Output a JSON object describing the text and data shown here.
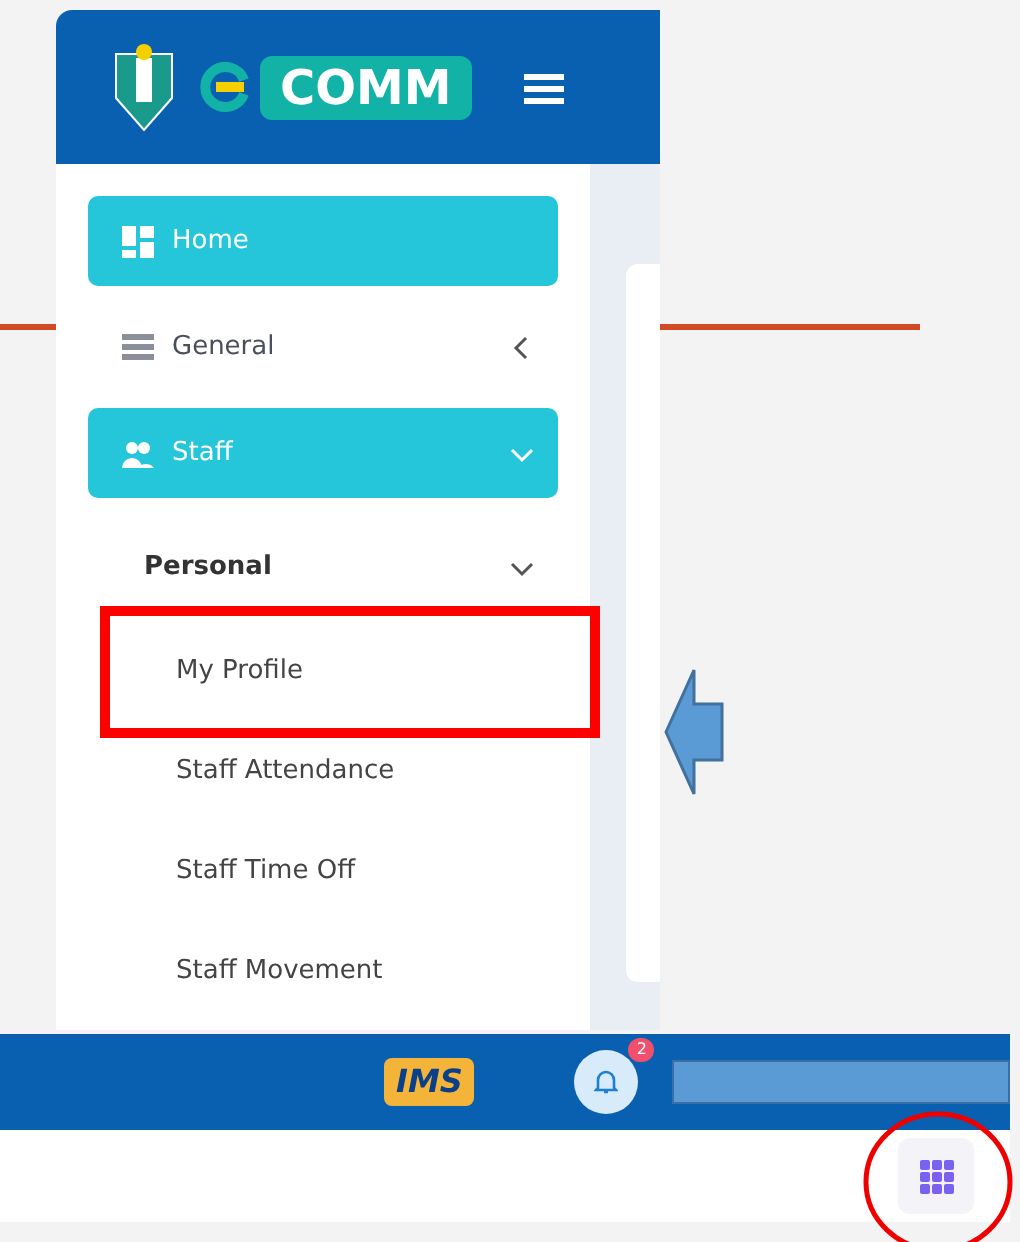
{
  "sidebar": {
    "logo_text": "COMM",
    "items": [
      {
        "kind": "main",
        "label": "Home",
        "active": true
      },
      {
        "kind": "main",
        "label": "General",
        "active": false,
        "expanded": false
      },
      {
        "kind": "main",
        "label": "Staff",
        "active": true,
        "expanded": true
      },
      {
        "kind": "group",
        "label": "Personal",
        "expanded": true
      },
      {
        "kind": "sub",
        "label": "My Profile",
        "highlighted": true
      },
      {
        "kind": "sub",
        "label": "Staff Attendance"
      },
      {
        "kind": "sub",
        "label": "Staff Time Off"
      },
      {
        "kind": "sub",
        "label": "Staff Movement"
      }
    ]
  },
  "topbar": {
    "logo_text": "IMS",
    "notification_count": "2"
  }
}
